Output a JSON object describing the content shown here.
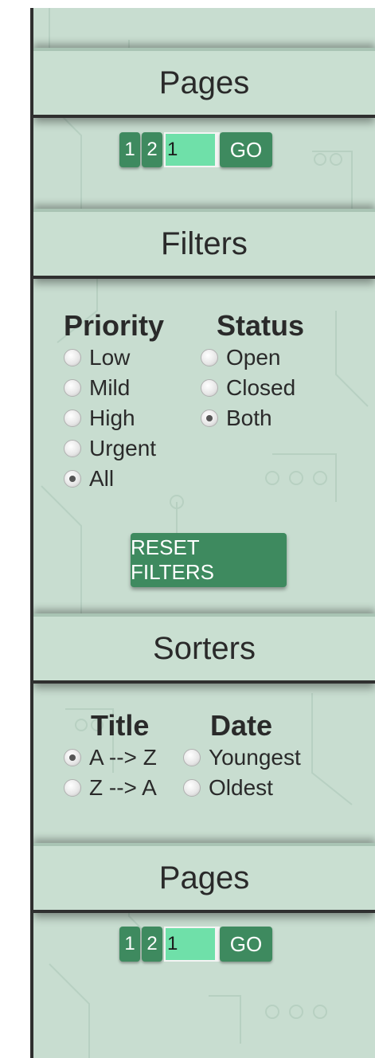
{
  "pages_top": {
    "title": "Pages",
    "page_buttons": [
      "1",
      "2"
    ],
    "page_input_value": "1",
    "go_label": "GO"
  },
  "filters": {
    "title": "Filters",
    "priority": {
      "label": "Priority",
      "options": [
        "Low",
        "Mild",
        "High",
        "Urgent",
        "All"
      ],
      "selected": "All"
    },
    "status": {
      "label": "Status",
      "options": [
        "Open",
        "Closed",
        "Both"
      ],
      "selected": "Both"
    },
    "reset_label": "RESET FILTERS"
  },
  "sorters": {
    "title": "Sorters",
    "title_sort": {
      "label": "Title",
      "options": [
        "A --> Z",
        "Z --> A"
      ],
      "selected": "A --> Z"
    },
    "date_sort": {
      "label": "Date",
      "options": [
        "Youngest",
        "Oldest"
      ],
      "selected": null
    }
  },
  "pages_bottom": {
    "title": "Pages",
    "page_buttons": [
      "1",
      "2"
    ],
    "page_input_value": "1",
    "go_label": "GO"
  },
  "colors": {
    "panel_bg": "#c8ddd0",
    "button_green": "#3e8a5f",
    "input_green": "#6fe0a9",
    "header_border": "#2f2f2f"
  }
}
